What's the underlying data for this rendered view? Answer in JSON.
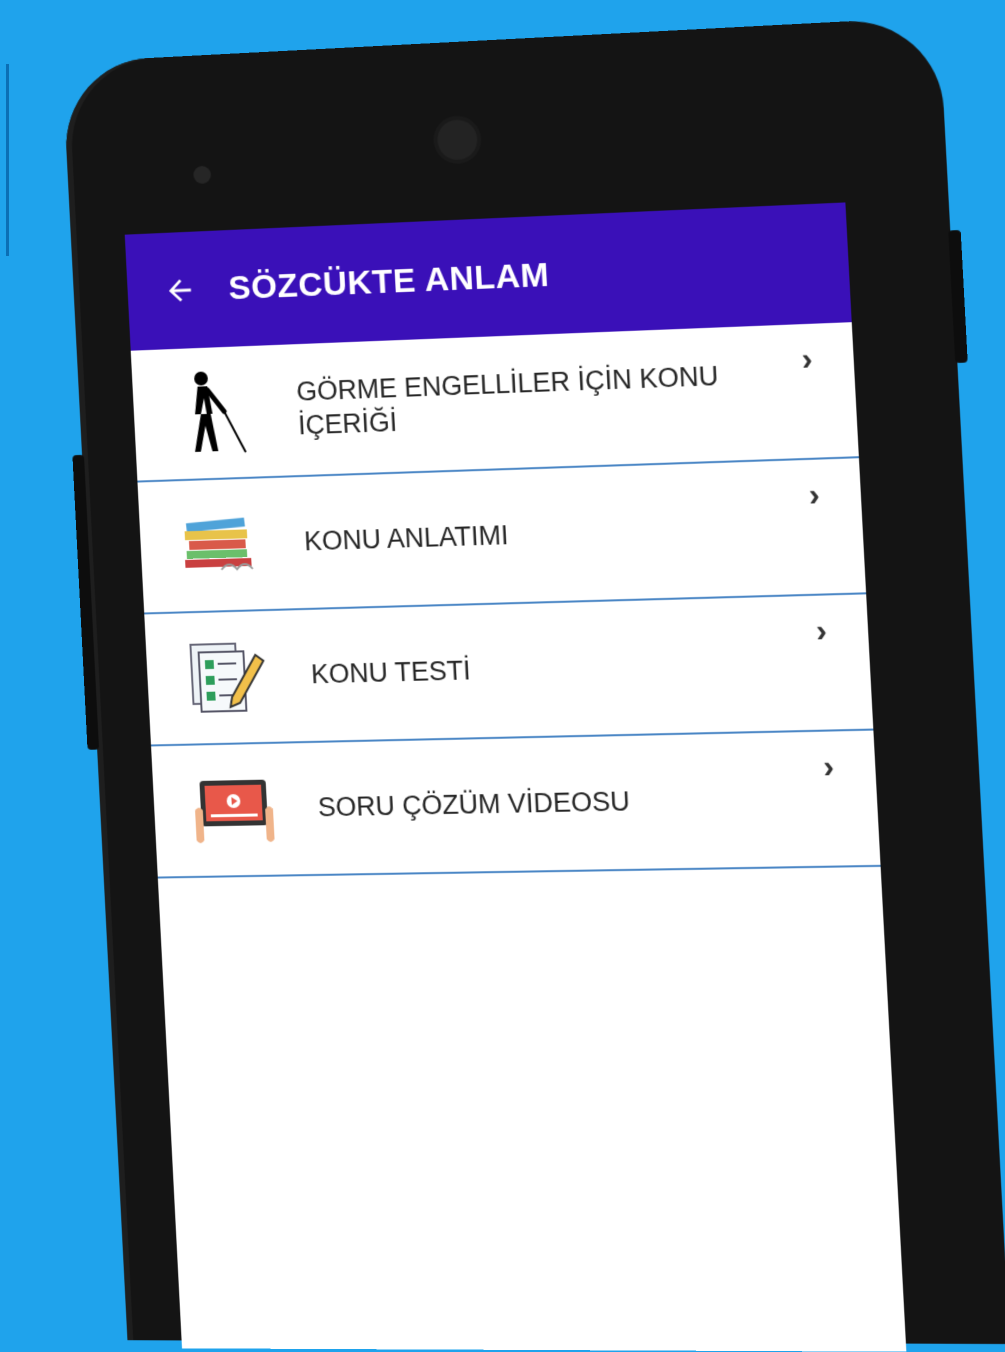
{
  "appbar": {
    "title": "SÖZCÜKTE ANLAM",
    "back_icon": "arrow-left-icon"
  },
  "menu": {
    "items": [
      {
        "label": "GÖRME ENGELLİLER İÇİN KONU İÇERİĞİ",
        "icon": "blind-person-icon",
        "chevron": "›"
      },
      {
        "label": "KONU ANLATIMI",
        "icon": "books-icon",
        "chevron": "›"
      },
      {
        "label": "KONU TESTİ",
        "icon": "checklist-pencil-icon",
        "chevron": "›"
      },
      {
        "label": "SORU ÇÖZÜM VİDEOSU",
        "icon": "video-tablet-icon",
        "chevron": "›"
      }
    ]
  },
  "colors": {
    "background": "#1fa3ec",
    "appbar": "#3a10b8",
    "divider": "#4a86c5",
    "phone_body": "#141414"
  }
}
